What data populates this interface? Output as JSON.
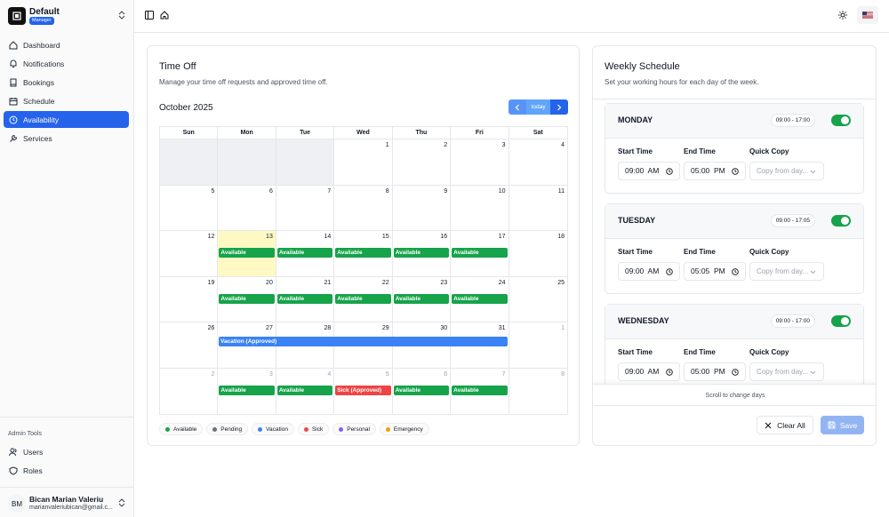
{
  "sidebar": {
    "brand": {
      "name": "Default",
      "role": "Manager"
    },
    "items": [
      {
        "label": "Dashboard",
        "icon": "dashboard-icon"
      },
      {
        "label": "Notifications",
        "icon": "bell-icon"
      },
      {
        "label": "Bookings",
        "icon": "book-icon"
      },
      {
        "label": "Schedule",
        "icon": "calendar-icon"
      },
      {
        "label": "Availability",
        "icon": "clock-icon",
        "active": true
      },
      {
        "label": "Services",
        "icon": "wrench-icon"
      }
    ],
    "admin_label": "Admin Tools",
    "admin_items": [
      {
        "label": "Users",
        "icon": "users-icon"
      },
      {
        "label": "Roles",
        "icon": "shield-icon"
      }
    ],
    "user": {
      "initials": "BM",
      "name": "Bican Marian Valeriu",
      "email": "marianvaleriubican@gmail.c..."
    }
  },
  "timeoff": {
    "title": "Time Off",
    "subtitle": "Manage your time off requests and approved time off.",
    "month": "October 2025",
    "today_label": "today",
    "weekdays": [
      "Sun",
      "Mon",
      "Tue",
      "Wed",
      "Thu",
      "Fri",
      "Sat"
    ],
    "weeks": [
      [
        "",
        "",
        "",
        "1",
        "2",
        "3",
        "4"
      ],
      [
        "5",
        "6",
        "7",
        "8",
        "9",
        "10",
        "11"
      ],
      [
        "12",
        "13",
        "14",
        "15",
        "16",
        "17",
        "18"
      ],
      [
        "19",
        "20",
        "21",
        "22",
        "23",
        "24",
        "25"
      ],
      [
        "26",
        "27",
        "28",
        "29",
        "30",
        "31",
        "1"
      ],
      [
        "2",
        "3",
        "4",
        "5",
        "6",
        "7",
        "8"
      ]
    ],
    "available_label": "Available",
    "sick_label": "Sick (Approved)",
    "vacation_label": "Vacation (Approved)",
    "legend": [
      {
        "label": "Available",
        "color": "#16a34a"
      },
      {
        "label": "Pending",
        "color": "#6b7280"
      },
      {
        "label": "Vacation",
        "color": "#3b82f6"
      },
      {
        "label": "Sick",
        "color": "#ef4444"
      },
      {
        "label": "Personal",
        "color": "#8b5cf6"
      },
      {
        "label": "Emergency",
        "color": "#f59e0b"
      }
    ]
  },
  "weekly": {
    "title": "Weekly Schedule",
    "subtitle": "Set your working hours for each day of the week.",
    "start_label": "Start Time",
    "end_label": "End Time",
    "copy_label": "Quick Copy",
    "copy_placeholder": "Copy from day...",
    "days": [
      {
        "name": "MONDAY",
        "hours": "09:00 - 17:00",
        "start": "09:00  AM",
        "end": "05:00  PM"
      },
      {
        "name": "TUESDAY",
        "hours": "09:00 - 17:05",
        "start": "09:00  AM",
        "end": "05:05  PM"
      },
      {
        "name": "WEDNESDAY",
        "hours": "09:00 - 17:00",
        "start": "09:00  AM",
        "end": "05:00  PM"
      }
    ],
    "scroll_hint": "Scroll to change days",
    "clear_label": "Clear All",
    "save_label": "Save"
  }
}
